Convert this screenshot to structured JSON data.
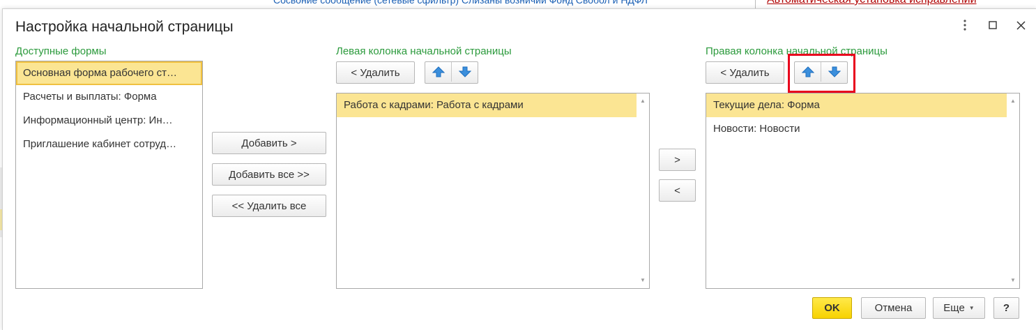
{
  "background": {
    "top_left_text": "Сосвоние сообщение (сетевые сфильтр) Слизаны возничии Фонд Свобол и НДФЛ",
    "top_right_link": "Автоматическая установка исправлений"
  },
  "dialog": {
    "title": "Настройка начальной страницы",
    "icons": [
      "more-icon",
      "maximize-icon",
      "close-icon"
    ]
  },
  "available": {
    "label": "Доступные формы",
    "items": [
      "Основная форма рабочего ст…",
      "Расчеты и выплаты: Форма",
      "Информационный центр: Ин…",
      "Приглашение кабинет сотруд…"
    ]
  },
  "middle_buttons": {
    "add": "Добавить >",
    "add_all": "Добавить все >>",
    "remove_all": "<< Удалить все"
  },
  "left_column": {
    "label": "Левая колонка начальной страницы",
    "remove": "< Удалить",
    "items": [
      "Работа с кадрами: Работа с кадрами"
    ]
  },
  "transfer_buttons": {
    "right": ">",
    "left": "<"
  },
  "right_column": {
    "label": "Правая колонка начальной страницы",
    "remove": "< Удалить",
    "items": [
      "Текущие дела: Форма",
      "Новости: Новости"
    ]
  },
  "footer": {
    "ok": "OK",
    "cancel": "Отмена",
    "more": "Еще",
    "help": "?"
  },
  "colors": {
    "label_green": "#2b9a3c",
    "selected_row": "#fbe593",
    "ok_yellow": "#f7d200",
    "highlight_red": "#e8001c",
    "arrow_blue": "#3b8fdc"
  }
}
